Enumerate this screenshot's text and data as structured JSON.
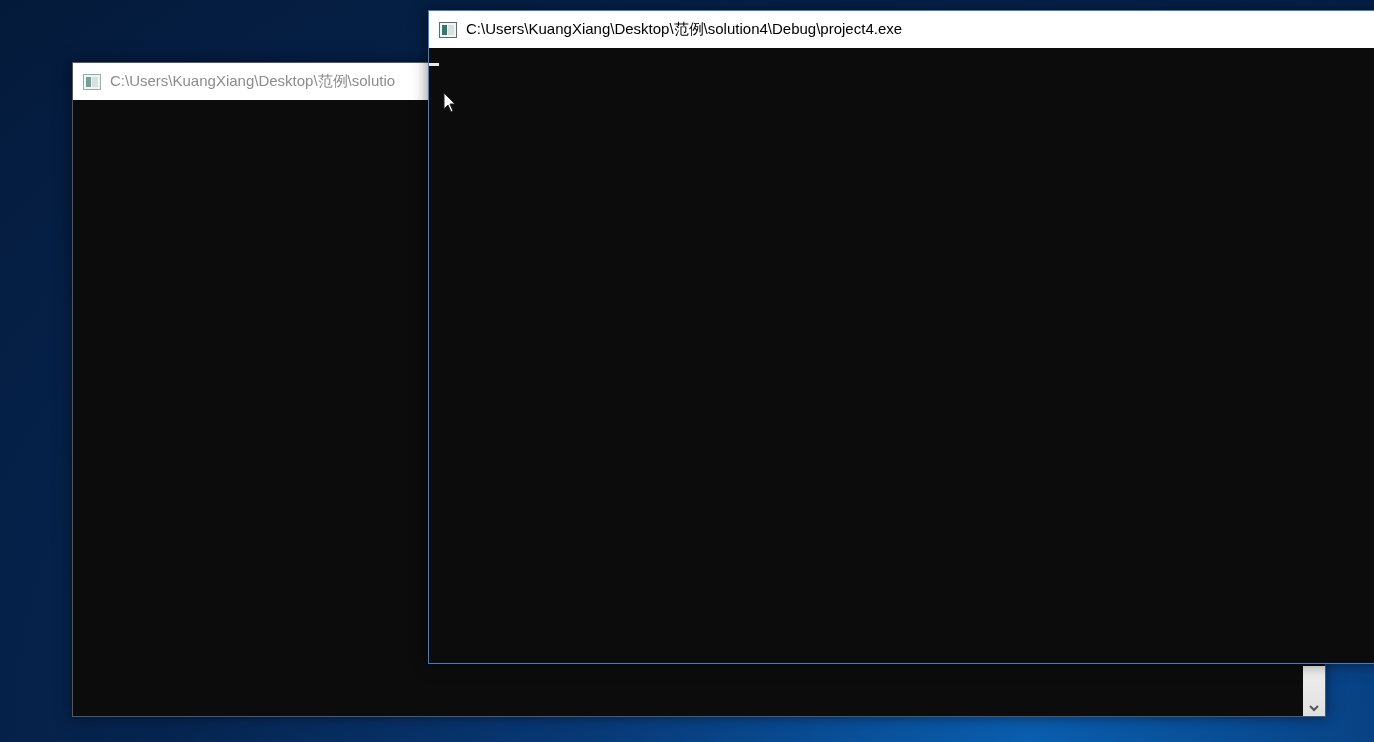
{
  "windows": [
    {
      "title": "C:\\Users\\KuangXiang\\Desktop\\范例\\solutio",
      "active": false
    },
    {
      "title": "C:\\Users\\KuangXiang\\Desktop\\范例\\solution4\\Debug\\project4.exe",
      "active": true
    }
  ]
}
